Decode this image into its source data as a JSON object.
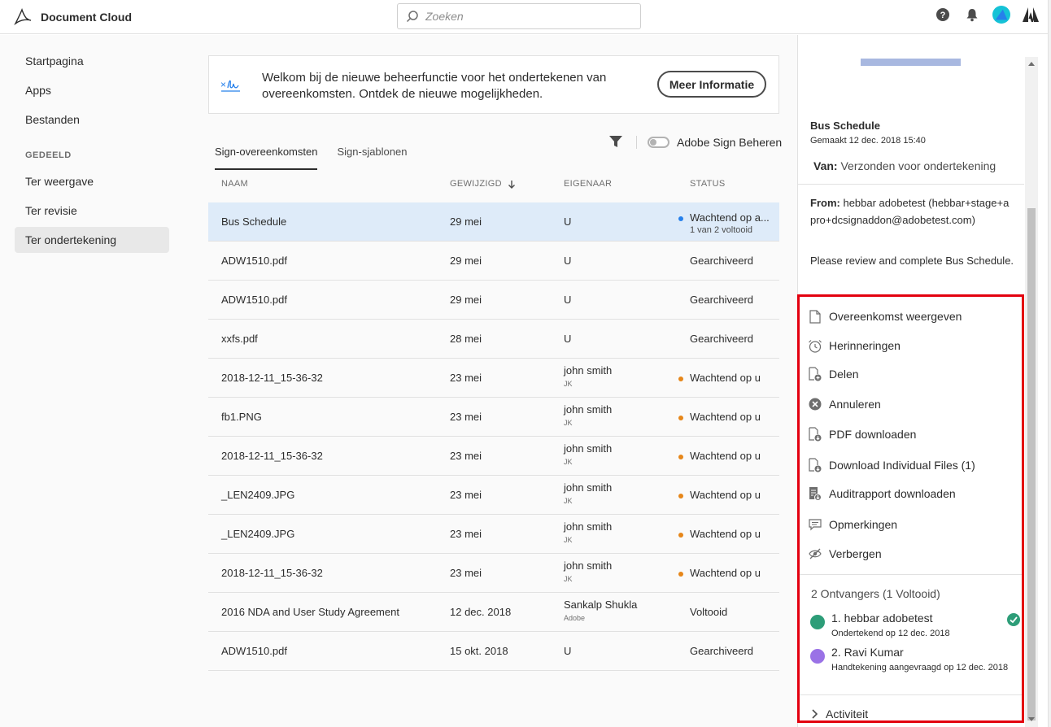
{
  "app": {
    "name": "Document Cloud"
  },
  "search": {
    "placeholder": "Zoeken"
  },
  "sidebar": {
    "items": [
      {
        "label": "Startpagina"
      },
      {
        "label": "Apps"
      },
      {
        "label": "Bestanden"
      }
    ],
    "section_label": "GEDEELD",
    "shared_items": [
      {
        "label": "Ter weergave"
      },
      {
        "label": "Ter revisie"
      },
      {
        "label": "Ter ondertekening"
      }
    ]
  },
  "banner": {
    "text": "Welkom bij de nieuwe beheerfunctie voor het ondertekenen van overeenkomsten. Ontdek de nieuwe mogelijkheden.",
    "button_label": "Meer Informatie"
  },
  "tabs": [
    {
      "label": "Sign-overeenkomsten"
    },
    {
      "label": "Sign-sjablonen"
    }
  ],
  "toggle_label": "Adobe Sign Beheren",
  "table": {
    "headers": {
      "name": "NAAM",
      "modified": "GEWIJZIGD",
      "owner": "EIGENAAR",
      "status": "STATUS"
    },
    "rows": [
      {
        "name": "Bus Schedule",
        "date": "29 mei",
        "owner": "U",
        "owner_sub": "",
        "status": "Wachtend op a...",
        "status_sub": "1 van 2 voltooid",
        "dot": "#2680eb"
      },
      {
        "name": "ADW1510.pdf",
        "date": "29 mei",
        "owner": "U",
        "owner_sub": "",
        "status": "Gearchiveerd",
        "status_sub": "",
        "dot": ""
      },
      {
        "name": "ADW1510.pdf",
        "date": "29 mei",
        "owner": "U",
        "owner_sub": "",
        "status": "Gearchiveerd",
        "status_sub": "",
        "dot": ""
      },
      {
        "name": "xxfs.pdf",
        "date": "28 mei",
        "owner": "U",
        "owner_sub": "",
        "status": "Gearchiveerd",
        "status_sub": "",
        "dot": ""
      },
      {
        "name": "2018-12-11_15-36-32",
        "date": "23 mei",
        "owner": "john smith",
        "owner_sub": "JK",
        "status": "Wachtend op u",
        "status_sub": "",
        "dot": "#e68619"
      },
      {
        "name": "fb1.PNG",
        "date": "23 mei",
        "owner": "john smith",
        "owner_sub": "JK",
        "status": "Wachtend op u",
        "status_sub": "",
        "dot": "#e68619"
      },
      {
        "name": "2018-12-11_15-36-32",
        "date": "23 mei",
        "owner": "john smith",
        "owner_sub": "JK",
        "status": "Wachtend op u",
        "status_sub": "",
        "dot": "#e68619"
      },
      {
        "name": "_LEN2409.JPG",
        "date": "23 mei",
        "owner": "john smith",
        "owner_sub": "JK",
        "status": "Wachtend op u",
        "status_sub": "",
        "dot": "#e68619"
      },
      {
        "name": "_LEN2409.JPG",
        "date": "23 mei",
        "owner": "john smith",
        "owner_sub": "JK",
        "status": "Wachtend op u",
        "status_sub": "",
        "dot": "#e68619"
      },
      {
        "name": "2018-12-11_15-36-32",
        "date": "23 mei",
        "owner": "john smith",
        "owner_sub": "JK",
        "status": "Wachtend op u",
        "status_sub": "",
        "dot": "#e68619"
      },
      {
        "name": "2016 NDA and User Study Agreement",
        "date": "12 dec. 2018",
        "owner": "Sankalp Shukla",
        "owner_sub": "Adobe",
        "status": "Voltooid",
        "status_sub": "",
        "dot": ""
      },
      {
        "name": "ADW1510.pdf",
        "date": "15 okt. 2018",
        "owner": "U",
        "owner_sub": "",
        "status": "Gearchiveerd",
        "status_sub": "",
        "dot": ""
      }
    ]
  },
  "details": {
    "title": "Bus Schedule",
    "created": "Gemaakt 12 dec. 2018 15:40",
    "van_label": "Van:",
    "van_value": "Verzonden voor ondertekening",
    "from_label": "From:",
    "from_value": "hebbar adobetest (hebbar+stage+apro+dcsignaddon@adobetest.com)",
    "message": "Please review and complete Bus Schedule."
  },
  "actions": [
    {
      "label": "Overeenkomst weergeven",
      "icon": "document-icon"
    },
    {
      "label": "Herinneringen",
      "icon": "alarm-clock-icon"
    },
    {
      "label": "Delen",
      "icon": "share-document-icon"
    },
    {
      "label": "Annuleren",
      "icon": "cancel-icon"
    },
    {
      "label": "PDF downloaden",
      "icon": "pdf-download-icon"
    },
    {
      "label": "Download Individual Files (1)",
      "icon": "file-download-icon"
    },
    {
      "label": "Auditrapport downloaden",
      "icon": "audit-report-icon"
    },
    {
      "label": "Opmerkingen",
      "icon": "comment-icon"
    },
    {
      "label": "Verbergen",
      "icon": "hide-icon"
    }
  ],
  "recipients": {
    "heading": "2 Ontvangers (1 Voltooid)",
    "list": [
      {
        "name": "1. hebbar adobetest",
        "sub": "Ondertekend op 12 dec. 2018",
        "color": "#2d9d78",
        "done": true
      },
      {
        "name": "2. Ravi Kumar",
        "sub": "Handtekening aangevraagd op 12 dec. 2018",
        "color": "#9a72e6",
        "done": false
      }
    ]
  },
  "activity_label": "Activiteit",
  "colors": {
    "accent_blue": "#2680eb",
    "waiting_orange": "#e68619",
    "highlight_red": "#e3000f",
    "selected_row": "#deebf9"
  }
}
